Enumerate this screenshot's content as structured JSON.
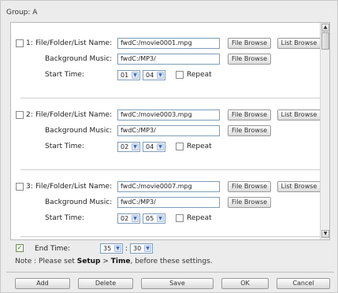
{
  "group": {
    "title": "Group: A"
  },
  "labels": {
    "file_folder_list_name": "File/Folder/List Name:",
    "background_music": "Background Music:",
    "start_time": "Start Time:",
    "repeat": "Repeat",
    "file_browse": "File Browse",
    "list_browse": "List Browse",
    "colon": ":"
  },
  "entries": [
    {
      "index": "1:",
      "file": "fwdC:/movie0001.mpg",
      "music": "fwdC:/MP3/",
      "hour": "01",
      "minute": "04",
      "repeat": false,
      "checked": false
    },
    {
      "index": "2:",
      "file": "fwdC:/movie0003.mpg",
      "music": "fwdC:/MP3/",
      "hour": "02",
      "minute": "04",
      "repeat": false,
      "checked": false
    },
    {
      "index": "3:",
      "file": "fwdC:/movie0007.mpg",
      "music": "fwdC:/MP3/",
      "hour": "02",
      "minute": "05",
      "repeat": false,
      "checked": false
    }
  ],
  "end_time": {
    "label": "End Time:",
    "hour": "35",
    "minute": "30",
    "checked": true
  },
  "note": {
    "prefix": "Note : Please set ",
    "setup": "Setup",
    "arrow": " > ",
    "time": "Time",
    "suffix": ", before these settings."
  },
  "buttons": {
    "add": "Add",
    "delete": "Delete",
    "save": "Save",
    "ok": "OK",
    "cancel": "Cancel"
  },
  "icons": {
    "dropdown": "chevron-down-icon",
    "scroll_up": "arrow-up-icon",
    "scroll_down": "arrow-down-icon",
    "check": "checkmark-icon"
  },
  "colors": {
    "accent_blue": "#3a66b5",
    "input_border": "#7f9db9",
    "check_green": "#2e7d1d"
  }
}
